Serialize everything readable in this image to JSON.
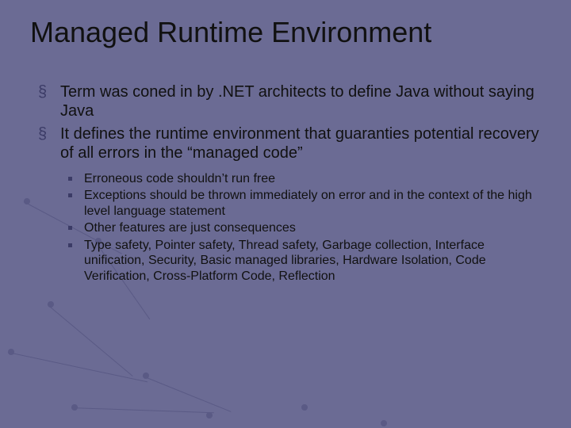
{
  "slide": {
    "title": "Managed Runtime Environment",
    "bullets": [
      "Term was coned in by .NET architects to define Java without saying Java",
      "It defines the runtime environment that guaranties potential recovery of all errors in the “managed code”"
    ],
    "sub_bullets": [
      "Erroneous code shouldn’t run free",
      "Exceptions should be thrown immediately on error and in the context of the high level language statement",
      "Other features are just consequences",
      "Type safety, Pointer safety, Thread safety, Garbage collection, Interface unification, Security, Basic managed libraries, Hardware Isolation, Code Verification, Cross-Platform Code, Reflection"
    ]
  }
}
